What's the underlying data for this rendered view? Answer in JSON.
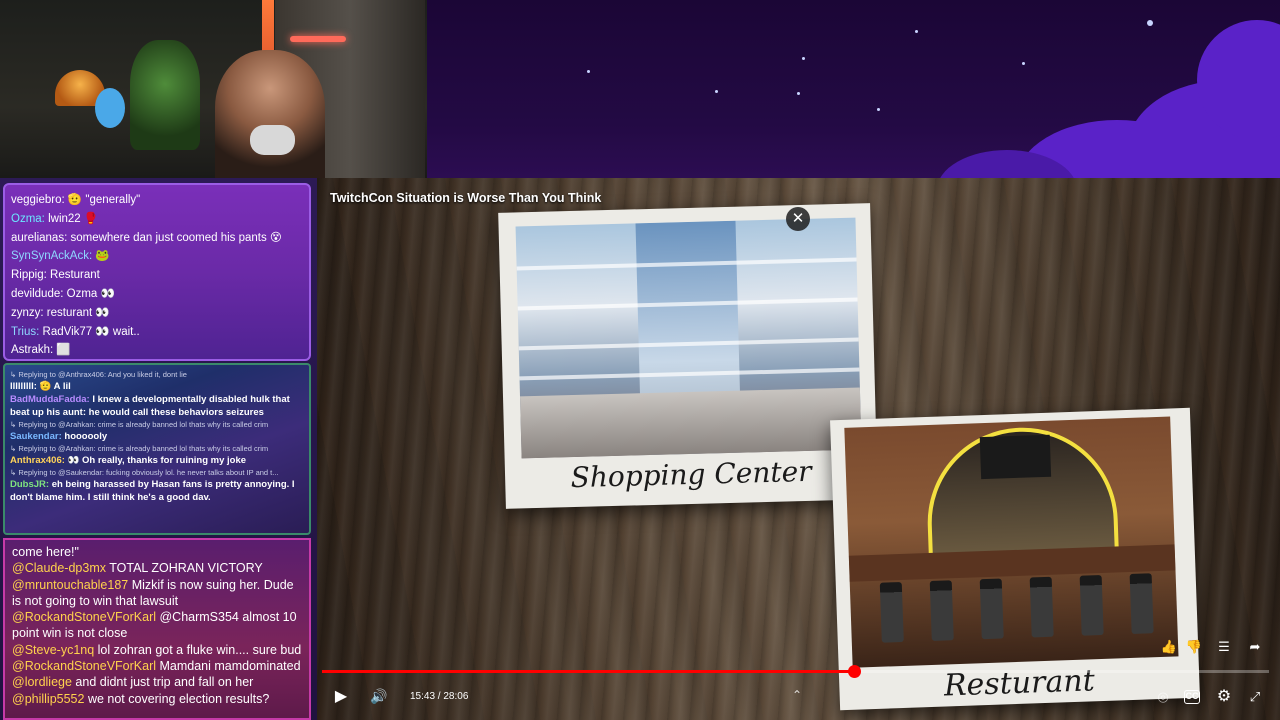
{
  "video": {
    "title": "TwitchCon Situation is Worse Than You Think",
    "time": "15:43 / 28:06",
    "progress_fraction": 0.562,
    "captions": {
      "shopping_center": "Shopping Center",
      "restaurant": "Resturant"
    }
  },
  "chat_top": {
    "messages": [
      {
        "user": "veggiebro:",
        "text": "🫡 \"generally\""
      },
      {
        "user": "Ozma:",
        "text": "lwin22 🥊"
      },
      {
        "user": "aurelianas:",
        "text": "somewhere dan just coomed his pants 😵"
      },
      {
        "user": "SynSynAckAck:",
        "text": "🐸"
      },
      {
        "user": "Rippig:",
        "text": "Resturant"
      },
      {
        "user": "devildude:",
        "text": "Ozma 👀"
      },
      {
        "user": "zynzy:",
        "text": "resturant 👀"
      },
      {
        "user": "Trius:",
        "text": "RadVik77 👀 wait.."
      },
      {
        "user": "Astrakh:",
        "text": "⬜"
      }
    ]
  },
  "chat_middle": {
    "reply1": "↳ Replying to @Anthrax406: And you liked it, dont lie",
    "line1_user": "lllllllll:",
    "line1_text": "🫡 A lil",
    "line2_user": "BadMuddaFadda:",
    "line2_text": "I knew a developmentally disabled hulk that beat up his aunt: he would call these behaviors seizures",
    "reply2": "↳ Replying to @Arahkan: crime is already banned lol thats why its called crim",
    "line3_user": "Saukendar:",
    "line3_text": "hoooooly",
    "reply3": "↳ Replying to @Arahkan: crime is already banned lol thats why its called crim",
    "line4_user": "Anthrax406:",
    "line4_text": "👀 Oh really, thanks for ruining my joke",
    "reply4": "↳ Replying to @Saukendar: fucking obviously lol. he never talks about IP and t...",
    "line5_user": "DubsJR:",
    "line5_text": "eh being harassed by Hasan fans is pretty annoying. I don't blame him. I still think he's a good dav."
  },
  "chat_bottom": {
    "lines": [
      {
        "mention": "",
        "text": "come here!\""
      },
      {
        "mention": "@Claude-dp3mx",
        "text": " TOTAL ZOHRAN VICTORY"
      },
      {
        "mention": "@mruntouchable187",
        "text": " Mizkif is now suing her. Dude is not going to win that lawsuit"
      },
      {
        "mention": "@RockandStoneVForKarl",
        "text": " @CharmS354 almost 10 point win is not close"
      },
      {
        "mention": "@Steve-yc1nq",
        "text": " lol zohran got a fluke win.... sure bud"
      },
      {
        "mention": "@RockandStoneVForKarl",
        "text": " Mamdani mamdominated"
      },
      {
        "mention": "@lordliege",
        "text": " and didnt just trip and fall on her"
      },
      {
        "mention": "@phillip5552",
        "text": " we not covering election results?"
      }
    ]
  },
  "icons": {
    "close": "✕",
    "play": "▶",
    "volume": "🔊",
    "chevron_up": "⌃",
    "like": "👍",
    "dislike": "👎",
    "comment": "☰",
    "share": "➦",
    "autoplay": "◎",
    "cc": "CC",
    "settings": "⚙",
    "fullscreen_exit": "⤢"
  },
  "colors": {
    "accent": "#ff0000",
    "mention": "#ffd24d"
  }
}
